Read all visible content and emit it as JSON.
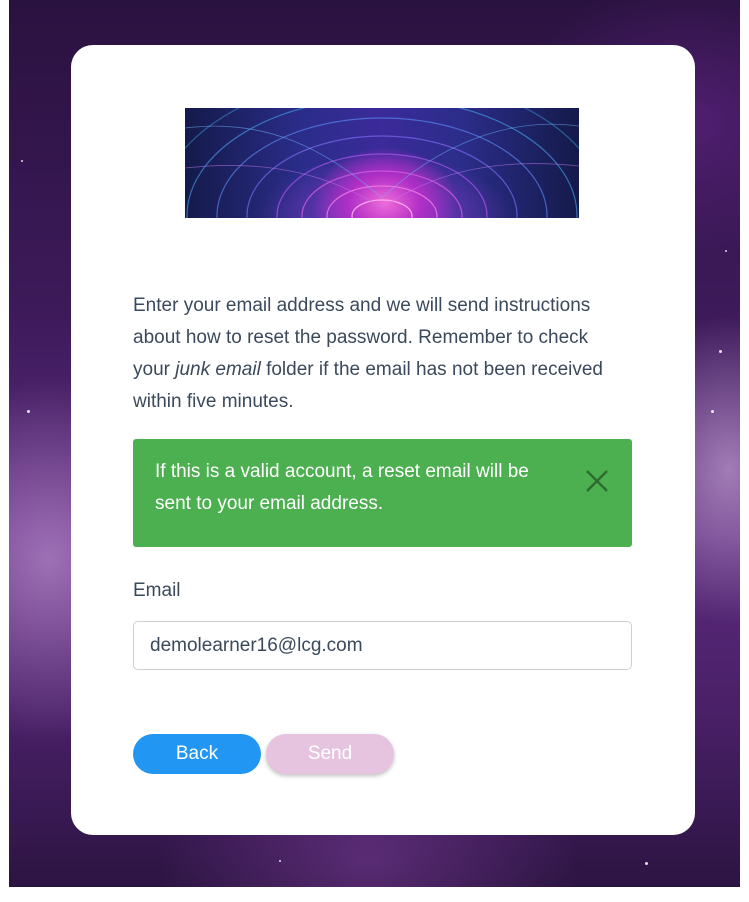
{
  "instructions": {
    "before_italic": "Enter your email address and we will send instructions about how to reset the password. Remember to check your ",
    "italic": "junk email",
    "after_italic": " folder if the email has not been received within five minutes."
  },
  "alert": {
    "message": "If this is a valid account, a reset email will be sent to your email address.",
    "close_icon": "close-icon",
    "color": "#4caf50"
  },
  "form": {
    "email_label": "Email",
    "email_value": "demolearner16@lcg.com"
  },
  "buttons": {
    "back_label": "Back",
    "send_label": "Send",
    "back_color": "#2196f3",
    "send_color": "#e6c4e0"
  }
}
